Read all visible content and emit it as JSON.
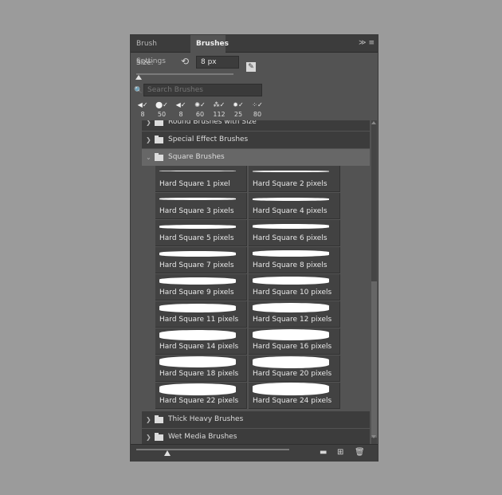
{
  "tabs": [
    "Brush Settings",
    "Brushes"
  ],
  "header": {
    "menu_glyph": "≫ ≡"
  },
  "size": {
    "label": "Size:",
    "value": "8 px",
    "reset_glyph": "⟲",
    "edit_glyph": "✎"
  },
  "search": {
    "placeholder": "Search Brushes",
    "icon": "🔍"
  },
  "recent_brushes": [
    {
      "glyph": "◀✓",
      "size": "8"
    },
    {
      "glyph": "⬤✓",
      "size": "50"
    },
    {
      "glyph": "◀✓",
      "size": "8"
    },
    {
      "glyph": "✺✓",
      "size": "60"
    },
    {
      "glyph": "⁂✓",
      "size": "112"
    },
    {
      "glyph": "✹✓",
      "size": "25"
    },
    {
      "glyph": "⁘✓",
      "size": "80"
    }
  ],
  "groups": {
    "round": "Round Brushes with Size",
    "special": "Special Effect Brushes",
    "square": "Square Brushes",
    "thick": "Thick Heavy Brushes",
    "wet": "Wet Media Brushes"
  },
  "chevrons": {
    "closed": "❯",
    "open": "⌄"
  },
  "brushes": [
    "Hard Square 1 pixel",
    "Hard Square 2 pixels",
    "Hard Square 3 pixels",
    "Hard Square 4 pixels",
    "Hard Square 5 pixels",
    "Hard Square 6 pixels",
    "Hard Square 7 pixels",
    "Hard Square 8 pixels",
    "Hard Square 9 pixels",
    "Hard Square 10 pixels",
    "Hard Square 11 pixels",
    "Hard Square 12 pixels",
    "Hard Square 14 pixels",
    "Hard Square 16 pixels",
    "Hard Square 18 pixels",
    "Hard Square 20 pixels",
    "Hard Square 22 pixels",
    "Hard Square 24 pixels"
  ],
  "footer": {
    "folder_icon": "▬",
    "new_icon": "⊞",
    "trash_icon": "🗑"
  }
}
